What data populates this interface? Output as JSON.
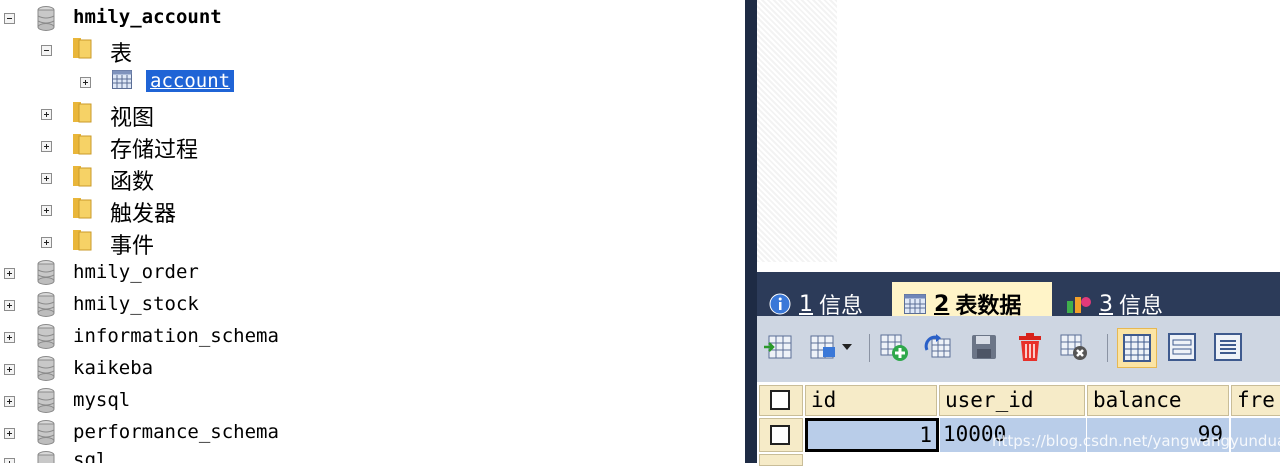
{
  "tree": {
    "root_db": "hmily_account",
    "tables_folder": "表",
    "selected_table": "account",
    "folders": [
      "视图",
      "存储过程",
      "函数",
      "触发器",
      "事件"
    ],
    "other_dbs": [
      "hmily_order",
      "hmily_stock",
      "information_schema",
      "kaikeba",
      "mysql",
      "performance_schema",
      "sql"
    ]
  },
  "tabs": [
    {
      "num": "1",
      "label": "信息"
    },
    {
      "num": "2",
      "label": "表数据"
    },
    {
      "num": "3",
      "label": "信息"
    }
  ],
  "grid": {
    "columns": [
      "id",
      "user_id",
      "balance",
      "fre"
    ],
    "rows": [
      {
        "id": "1",
        "user_id": "10000",
        "balance": "99"
      }
    ]
  },
  "watermark": "https://blog.csdn.net/yangwangyunduan",
  "colors": {
    "selection": "#1f64d6",
    "tab_bar": "#2c3b59",
    "toolbar": "#ced6e2",
    "header": "#f6ebc8",
    "row_selected": "#b9cde9"
  }
}
